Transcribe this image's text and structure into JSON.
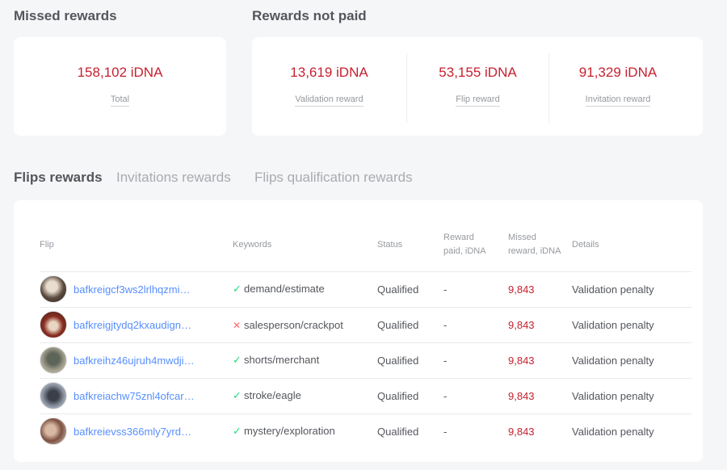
{
  "missed_rewards": {
    "title": "Missed rewards",
    "total_value": "158,102 iDNA",
    "total_label": "Total"
  },
  "rewards_not_paid": {
    "title": "Rewards not paid",
    "stats": [
      {
        "value": "13,619 iDNA",
        "label": "Validation reward"
      },
      {
        "value": "53,155 iDNA",
        "label": "Flip reward"
      },
      {
        "value": "91,329 iDNA",
        "label": "Invitation reward"
      }
    ]
  },
  "tabs": [
    {
      "label": "Flips rewards",
      "active": true
    },
    {
      "label": "Invitations rewards",
      "active": false
    },
    {
      "label": "Flips qualification rewards",
      "active": false
    }
  ],
  "table": {
    "headers": {
      "flip": "Flip",
      "keywords": "Keywords",
      "status": "Status",
      "reward_paid_1": "Reward",
      "reward_paid_2": "paid, iDNA",
      "missed_1": "Missed",
      "missed_2": "reward, iDNA",
      "details": "Details"
    },
    "rows": [
      {
        "flip": "bafkreigcf3ws2lrlhqzmi…",
        "keyword_icon": "check-icon",
        "keywords": "demand/estimate",
        "status": "Qualified",
        "reward_paid": "-",
        "missed": "9,843",
        "details": "Validation penalty"
      },
      {
        "flip": "bafkreigjtydq2kxaudign…",
        "keyword_icon": "cross-icon",
        "keywords": "salesperson/crackpot",
        "status": "Qualified",
        "reward_paid": "-",
        "missed": "9,843",
        "details": "Validation penalty"
      },
      {
        "flip": "bafkreihz46ujruh4mwdji…",
        "keyword_icon": "check-icon",
        "keywords": "shorts/merchant",
        "status": "Qualified",
        "reward_paid": "-",
        "missed": "9,843",
        "details": "Validation penalty"
      },
      {
        "flip": "bafkreiachw75znl4ofcar…",
        "keyword_icon": "check-icon",
        "keywords": "stroke/eagle",
        "status": "Qualified",
        "reward_paid": "-",
        "missed": "9,843",
        "details": "Validation penalty"
      },
      {
        "flip": "bafkreievss366mly7yrd…",
        "keyword_icon": "check-icon",
        "keywords": "mystery/exploration",
        "status": "Qualified",
        "reward_paid": "-",
        "missed": "9,843",
        "details": "Validation penalty"
      }
    ]
  },
  "colors": {
    "accent_red": "#c7202f",
    "link_blue": "#578fff",
    "ok_green": "#27d980",
    "bad_red": "#ff6666"
  }
}
